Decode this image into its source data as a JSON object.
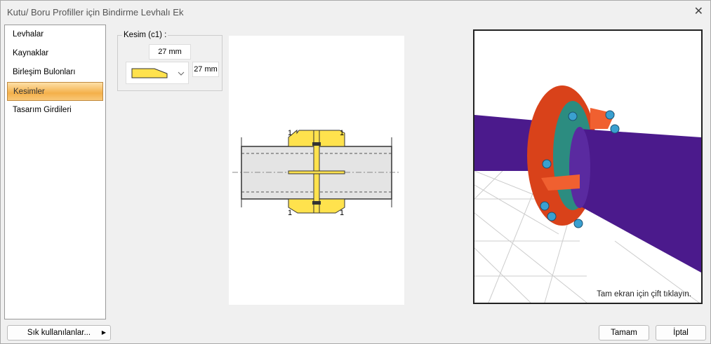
{
  "window": {
    "title": "Kutu/ Boru Profiller için Bindirme Levhalı Ek"
  },
  "sidebar": {
    "items": [
      {
        "label": "Levhalar"
      },
      {
        "label": "Kaynaklar"
      },
      {
        "label": "Birleşim Bulonları"
      },
      {
        "label": "Kesimler",
        "active": true
      },
      {
        "label": "Tasarım Girdileri"
      }
    ]
  },
  "cut": {
    "group_label": "Kesim (c1) :",
    "top_value": "27 mm",
    "side_value": "27 mm"
  },
  "drawing": {
    "section_marks": [
      "1",
      "1",
      "1",
      "1"
    ]
  },
  "view3d": {
    "hint": "Tam ekran için çift tıklayın."
  },
  "footer": {
    "favorites": "Sık kullanılanlar...",
    "ok": "Tamam",
    "cancel": "İptal"
  },
  "colors": {
    "accent": "#f4b04a",
    "plate": "#ffe24d",
    "pipe": "#4b1a8c",
    "flange": "#e0451c"
  }
}
